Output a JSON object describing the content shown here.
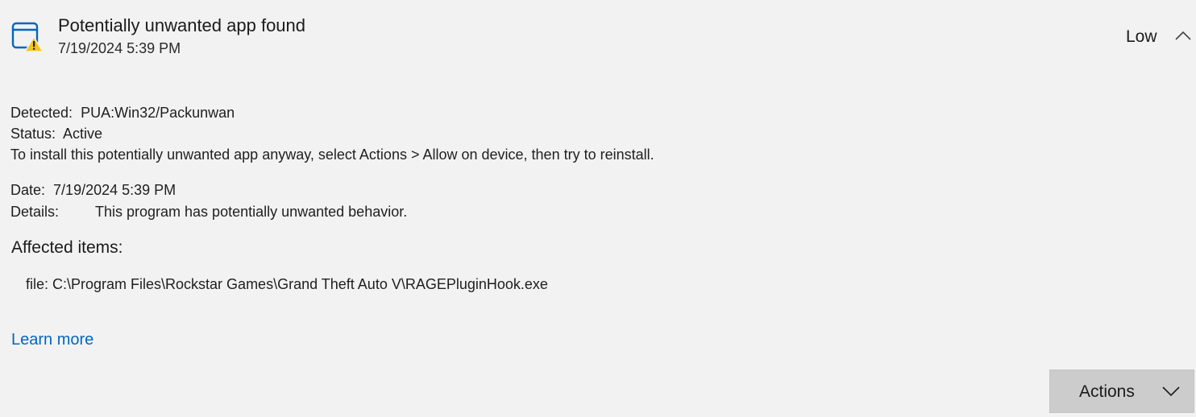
{
  "threat": {
    "title": "Potentially unwanted app found",
    "timestamp": "7/19/2024 5:39 PM",
    "severity": "Low",
    "icon": "app-window-warning-icon",
    "collapse_icon": "chevron-up-icon"
  },
  "details": {
    "detected_label": "Detected:",
    "detected_value": "PUA:Win32/Packunwan",
    "status_label": "Status:",
    "status_value": "Active",
    "hint": "To install this potentially unwanted app anyway, select Actions > Allow on device, then try to reinstall.",
    "date_label": "Date:",
    "date_value": "7/19/2024 5:39 PM",
    "details_label": "Details:",
    "details_value": "This program has potentially unwanted behavior."
  },
  "affected": {
    "heading": "Affected items:",
    "items": [
      "file: C:\\Program Files\\Rockstar Games\\Grand Theft Auto V\\RAGEPluginHook.exe"
    ]
  },
  "links": {
    "learn_more": "Learn more"
  },
  "actions": {
    "label": "Actions",
    "chevron_icon": "chevron-down-icon"
  },
  "colors": {
    "background": "#f2f2f2",
    "accent": "#0067c0",
    "warning": "#f5c518",
    "button_bg": "#cccccc"
  }
}
